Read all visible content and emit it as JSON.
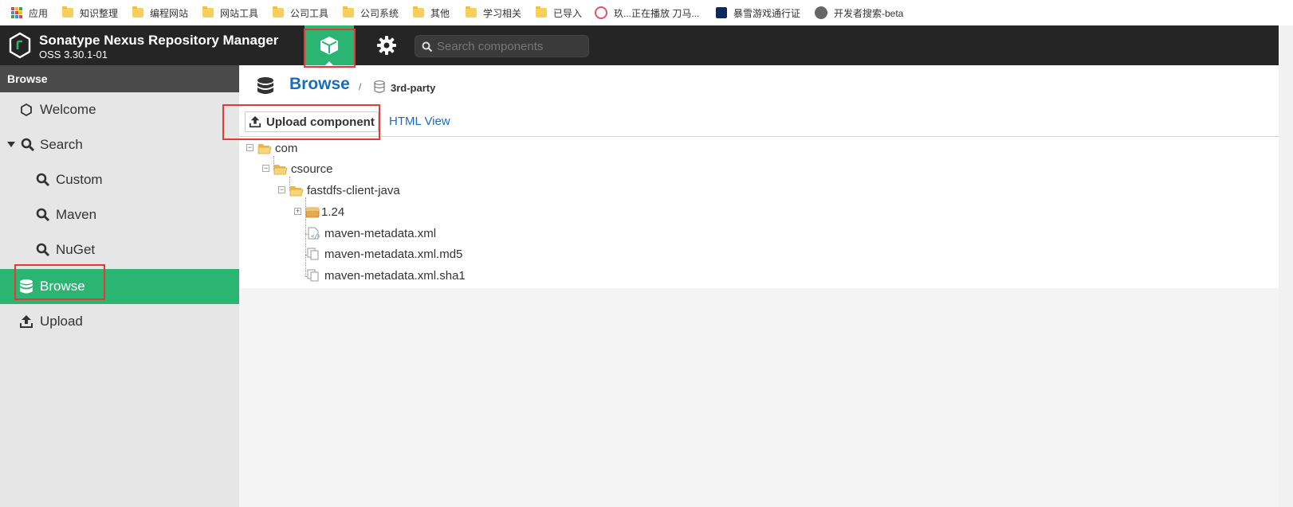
{
  "bookmarks": [
    {
      "label": "应用",
      "icon": "apps-grid-icon"
    },
    {
      "label": "知识整理",
      "icon": "folder-icon"
    },
    {
      "label": "编程网站",
      "icon": "folder-icon"
    },
    {
      "label": "网站工具",
      "icon": "folder-icon"
    },
    {
      "label": "公司工具",
      "icon": "folder-icon"
    },
    {
      "label": "公司系统",
      "icon": "folder-icon"
    },
    {
      "label": "其他",
      "icon": "folder-icon"
    },
    {
      "label": "学习相关",
      "icon": "folder-icon"
    },
    {
      "label": "已导入",
      "icon": "folder-icon"
    },
    {
      "label": "玖...正在播放 刀马...",
      "icon": "bilibili-icon"
    },
    {
      "label": "暴雪游戏通行证",
      "icon": "battlenet-icon"
    },
    {
      "label": "开发者搜索-beta",
      "icon": "globe-icon"
    }
  ],
  "header": {
    "title": "Sonatype Nexus Repository Manager",
    "version": "OSS 3.30.1-01",
    "search_placeholder": "Search components"
  },
  "sidebar": {
    "title": "Browse",
    "items": [
      {
        "label": "Welcome",
        "icon": "hexagon-icon",
        "active": false
      },
      {
        "label": "Search",
        "icon": "search-icon",
        "active": false,
        "expanded": true
      },
      {
        "label": "Custom",
        "icon": "search-icon",
        "active": false
      },
      {
        "label": "Maven",
        "icon": "search-icon",
        "active": false
      },
      {
        "label": "NuGet",
        "icon": "search-icon",
        "active": false
      },
      {
        "label": "Browse",
        "icon": "database-icon",
        "active": true
      },
      {
        "label": "Upload",
        "icon": "upload-icon",
        "active": false
      }
    ]
  },
  "main": {
    "title": "Browse",
    "breadcrumb_sep": "/",
    "breadcrumb": "3rd-party",
    "upload_button": "Upload component",
    "html_view_link": "HTML View",
    "tree": [
      {
        "label": "com",
        "type": "folder-open",
        "depth": 0
      },
      {
        "label": "csource",
        "type": "folder-open",
        "depth": 1
      },
      {
        "label": "fastdfs-client-java",
        "type": "folder-open",
        "depth": 2
      },
      {
        "label": "1.24",
        "type": "component",
        "depth": 3
      },
      {
        "label": "maven-metadata.xml",
        "type": "xml-file",
        "depth": 3
      },
      {
        "label": "maven-metadata.xml.md5",
        "type": "file",
        "depth": 3
      },
      {
        "label": "maven-metadata.xml.sha1",
        "type": "file",
        "depth": 3
      }
    ]
  },
  "colors": {
    "accent": "#2bb573",
    "header_bg": "#252525",
    "link": "#1a6dbb",
    "highlight": "#e53935"
  }
}
